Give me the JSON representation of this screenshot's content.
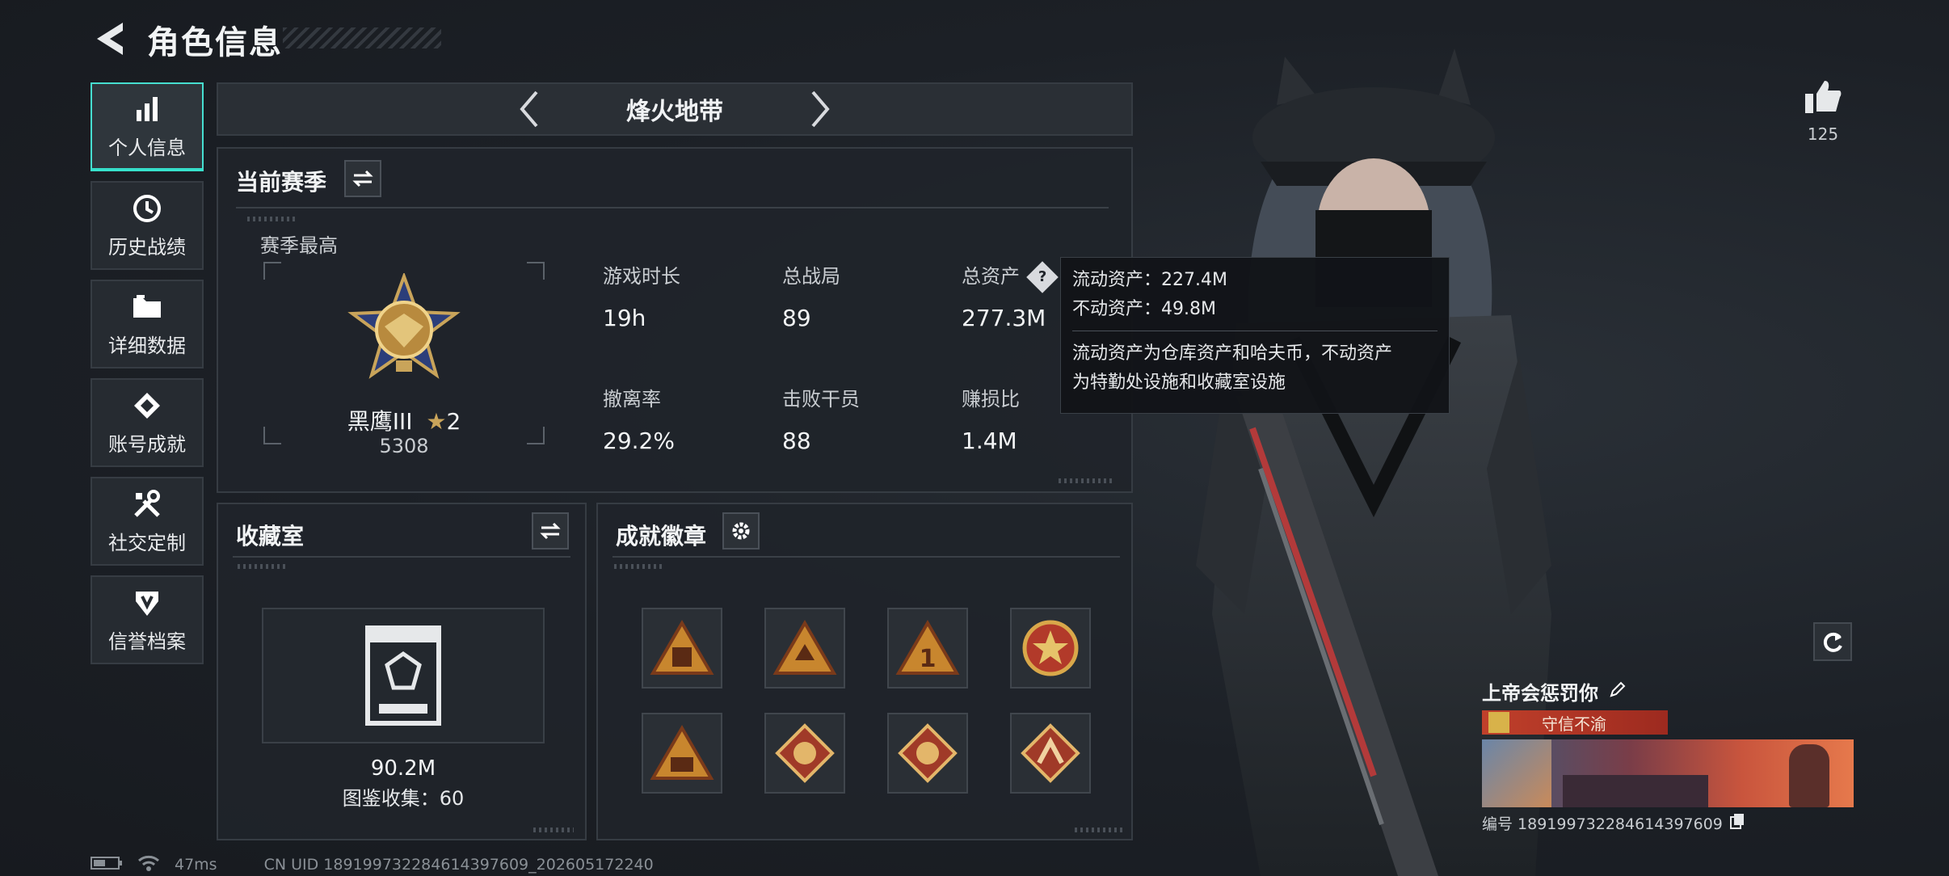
{
  "header": {
    "title": "角色信息"
  },
  "nav": {
    "items": [
      {
        "label": "个人信息",
        "active": true
      },
      {
        "label": "历史战绩"
      },
      {
        "label": "详细数据"
      },
      {
        "label": "账号成就"
      },
      {
        "label": "社交定制"
      },
      {
        "label": "信誉档案"
      }
    ]
  },
  "mode": {
    "name": "烽火地带"
  },
  "season": {
    "title": "当前赛季",
    "best_label": "赛季最高",
    "rank_name": "黑鹰III",
    "rank_stars": "2",
    "rank_score": "5308",
    "stats": [
      {
        "label": "游戏时长",
        "value": "19h"
      },
      {
        "label": "总战局",
        "value": "89"
      },
      {
        "label": "总资产",
        "value": "277.3M"
      },
      {
        "label": "撤离率",
        "value": "29.2%"
      },
      {
        "label": "击败干员",
        "value": "88"
      },
      {
        "label": "赚损比",
        "value": "1.4M"
      }
    ]
  },
  "tooltip": {
    "line1": "流动资产：227.4M",
    "line2": "不动资产：49.8M",
    "desc1": "流动资产为仓库资产和哈夫币，不动资产",
    "desc2": "为特勤处设施和收藏室设施"
  },
  "collection": {
    "title": "收藏室",
    "value": "90.2M",
    "catalog": "图鉴收集：60"
  },
  "badges": {
    "title": "成就徽章",
    "items": [
      "badge-1",
      "badge-2",
      "badge-3",
      "badge-4",
      "badge-5",
      "badge-6",
      "badge-7",
      "badge-8"
    ]
  },
  "status": {
    "ping": "47ms",
    "uid": "CN UID 18919973228461439​7609_202605172240"
  },
  "player": {
    "likes": "125",
    "name": "上帝会惩罚你",
    "title": "守信不渝",
    "id": "编号 18919973228461439​7609"
  },
  "colors": {
    "accent": "#36e0cb",
    "title_red": "#c0402b",
    "gold": "#c9a45a"
  }
}
